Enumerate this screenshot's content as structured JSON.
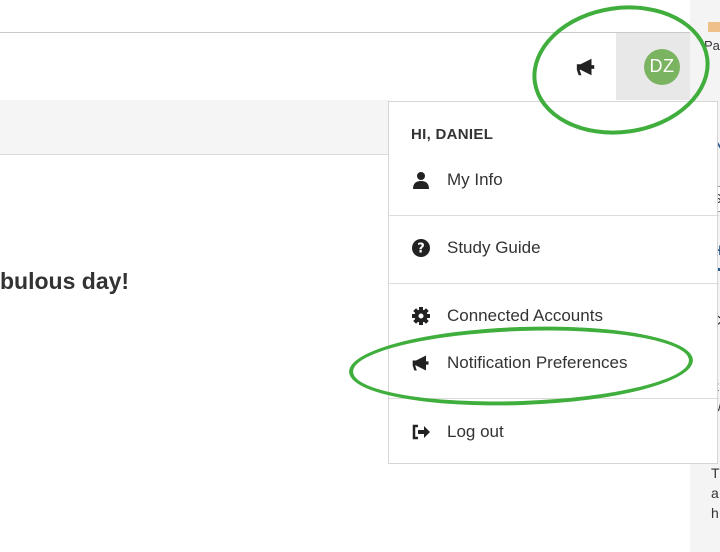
{
  "header": {
    "avatar_initials": "DZ",
    "avatar_color": "#7bb461"
  },
  "main": {
    "greeting": "bulous day!"
  },
  "dropdown": {
    "greeting": "HI, DANIEL",
    "items": [
      {
        "label": "My Info",
        "icon": "user-icon"
      },
      {
        "label": "Study Guide",
        "icon": "question-circle-icon"
      },
      {
        "label": "Connected Accounts",
        "icon": "gear-icon"
      },
      {
        "label": "Notification Preferences",
        "icon": "megaphone-icon"
      },
      {
        "label": "Log out",
        "icon": "sign-out-icon"
      }
    ]
  },
  "side_panel": {
    "fragments": [
      "Pa",
      "N",
      "S",
      "H",
      "C",
      "y",
      "It",
      "w",
      "y",
      "T",
      "a",
      "h"
    ]
  },
  "annotation_color": "#3fae3c"
}
